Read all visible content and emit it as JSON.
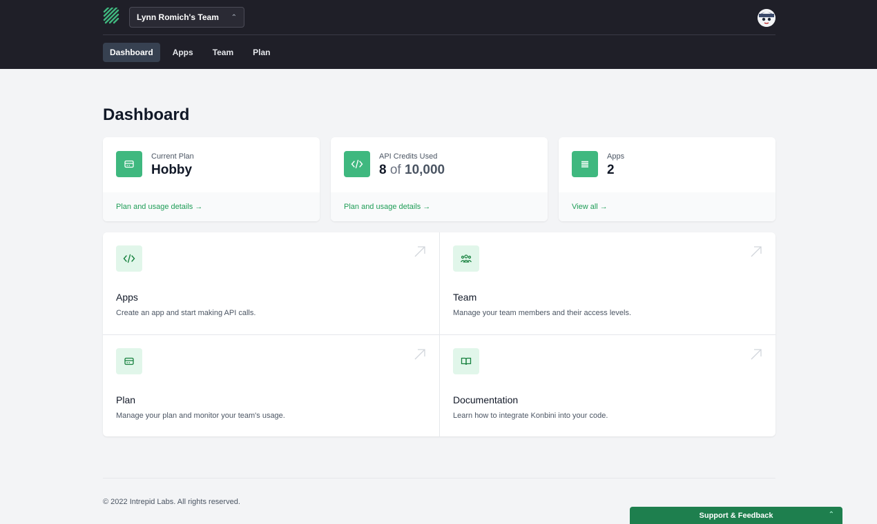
{
  "header": {
    "team_name": "Lynn Romich's Team",
    "nav": [
      {
        "label": "Dashboard",
        "active": true
      },
      {
        "label": "Apps"
      },
      {
        "label": "Team"
      },
      {
        "label": "Plan"
      }
    ]
  },
  "page": {
    "title": "Dashboard"
  },
  "stats": [
    {
      "label": "Current Plan",
      "value": "Hobby",
      "link": "Plan and usage details →"
    },
    {
      "label": "API Credits Used",
      "value_used": "8",
      "value_of": "of",
      "value_total": "10,000",
      "link": "Plan and usage details →"
    },
    {
      "label": "Apps",
      "value": "2",
      "link": "View all →"
    }
  ],
  "tiles": [
    {
      "title": "Apps",
      "desc": "Create an app and start making API calls."
    },
    {
      "title": "Team",
      "desc": "Manage your team members and their access levels."
    },
    {
      "title": "Plan",
      "desc": "Manage your plan and monitor your team's usage."
    },
    {
      "title": "Documentation",
      "desc": "Learn how to integrate Konbini into your code."
    }
  ],
  "footer": {
    "text": "© 2022 Intrepid Labs. All rights reserved."
  },
  "support": {
    "label": "Support & Feedback"
  },
  "colors": {
    "accent": "#3fb87f",
    "link": "#1f9d57",
    "topbar": "#1f1f28",
    "support": "#1e7f4e"
  }
}
